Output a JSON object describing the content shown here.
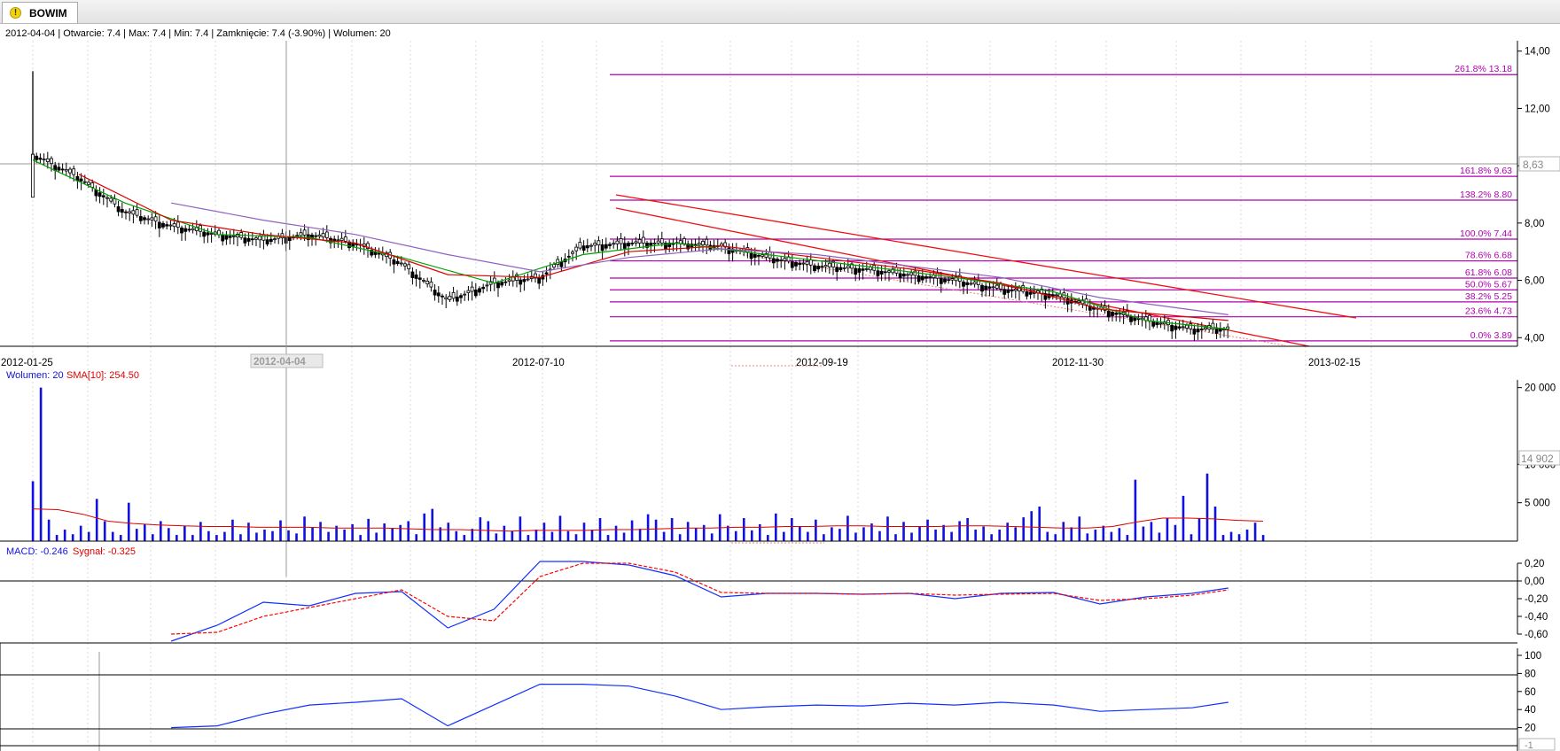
{
  "window": {
    "tab_title": "BOWIM",
    "tab_icon": "warning-icon"
  },
  "header_info": "2012-04-04 | Otwarcie: 7.4 | Max: 7.4 | Min: 7.4 | Zamknięcie: 7.4 (-3.90%)  | Wolumen: 20",
  "x_axis": {
    "labels": [
      "2012-01-25",
      "2012-07-10",
      "2012-09-19",
      "2012-11-30",
      "2013-02-15"
    ],
    "cursor_label": "2012-04-04"
  },
  "colors": {
    "candle": "#000000",
    "sma_green": "#00a000",
    "sma_red": "#e00000",
    "sma_purple": "#9060c0",
    "fib": "#b000b0",
    "trend": "#f01010",
    "volume": "#1010e0",
    "macd": "#1030ff",
    "signal": "#ff0000",
    "rsi": "#1030ff"
  },
  "chart_data": [
    {
      "type": "line",
      "panel": "price",
      "y_ticks": [
        "14,00",
        "12,00",
        "10,00",
        "8,00",
        "6,00",
        "4,00"
      ],
      "ylim": [
        3.7,
        14.3
      ],
      "crosshair_value": "8,63",
      "last_value": 4.3,
      "fibonacci": [
        {
          "label": "261.8% 13.18",
          "value": 13.18
        },
        {
          "label": "161.8% 9.63",
          "value": 9.63
        },
        {
          "label": "138.2% 8.80",
          "value": 8.8
        },
        {
          "label": "100.0% 7.44",
          "value": 7.44
        },
        {
          "label": "78.6% 6.68",
          "value": 6.68
        },
        {
          "label": "61.8% 6.08",
          "value": 6.08
        },
        {
          "label": "50.0% 5.67",
          "value": 5.67
        },
        {
          "label": "38.2% 5.25",
          "value": 5.25
        },
        {
          "label": "23.6% 4.73",
          "value": 4.73
        },
        {
          "label": "0.0% 3.89",
          "value": 3.89
        }
      ],
      "series": [
        {
          "role": "close",
          "x": [
            "2012-01-25",
            "2012-02-08",
            "2012-02-22",
            "2012-03-07",
            "2012-03-21",
            "2012-04-04",
            "2012-04-18",
            "2012-05-02",
            "2012-05-16",
            "2012-05-30",
            "2012-06-13",
            "2012-06-27",
            "2012-07-10",
            "2012-07-24",
            "2012-08-07",
            "2012-08-21",
            "2012-09-04",
            "2012-09-19",
            "2012-10-03",
            "2012-10-17",
            "2012-10-31",
            "2012-11-14",
            "2012-11-30",
            "2012-12-14",
            "2012-12-28",
            "2013-01-11",
            "2013-01-22"
          ],
          "values": [
            10.4,
            9.6,
            8.4,
            7.9,
            7.6,
            7.4,
            7.6,
            7.3,
            6.6,
            5.3,
            5.9,
            6.1,
            7.2,
            7.3,
            7.3,
            7.2,
            6.8,
            6.5,
            6.4,
            6.2,
            6.0,
            5.7,
            5.5,
            5.0,
            4.6,
            4.3,
            4.3
          ]
        },
        {
          "role": "sma-short",
          "x": [
            "2012-01-25",
            "2012-02-22",
            "2012-03-21",
            "2012-04-18",
            "2012-05-16",
            "2012-06-13",
            "2012-07-10",
            "2012-08-07",
            "2012-09-04",
            "2012-10-03",
            "2012-10-31",
            "2012-11-30",
            "2012-12-28",
            "2013-01-22"
          ],
          "values": [
            10.2,
            8.7,
            7.6,
            7.5,
            6.8,
            5.9,
            6.9,
            7.3,
            6.9,
            6.5,
            6.1,
            5.6,
            4.6,
            4.3
          ]
        },
        {
          "role": "sma-mid",
          "x": [
            "2012-02-08",
            "2012-03-07",
            "2012-04-04",
            "2012-05-02",
            "2012-05-30",
            "2012-06-27",
            "2012-07-24",
            "2012-08-21",
            "2012-09-19",
            "2012-10-17",
            "2012-11-14",
            "2012-12-14",
            "2013-01-22"
          ],
          "values": [
            9.7,
            8.1,
            7.6,
            7.3,
            6.2,
            6.1,
            7.0,
            7.2,
            6.8,
            6.4,
            5.9,
            5.0,
            4.6
          ]
        },
        {
          "role": "sma-long",
          "x": [
            "2012-03-07",
            "2012-04-04",
            "2012-05-02",
            "2012-05-30",
            "2012-06-27",
            "2012-07-24",
            "2012-08-21",
            "2012-09-19",
            "2012-10-17",
            "2012-11-14",
            "2012-12-14",
            "2013-01-22"
          ],
          "values": [
            8.7,
            8.1,
            7.6,
            6.9,
            6.3,
            6.8,
            7.1,
            6.9,
            6.5,
            6.1,
            5.4,
            4.8
          ]
        }
      ]
    },
    {
      "type": "bar",
      "panel": "volume",
      "legend": [
        {
          "text": "Wolumen: 20"
        },
        {
          "text": "SMA[10]: 254.50"
        }
      ],
      "y_ticks": [
        "20 000",
        "10 000",
        "5 000"
      ],
      "ylim": [
        0,
        21000
      ],
      "crosshair_value": "14 902",
      "values": [
        7800,
        20000,
        2800,
        800,
        1500,
        900,
        2000,
        1200,
        5500,
        2600,
        1200,
        800,
        5000,
        1600,
        2200,
        900,
        2600,
        1700,
        800,
        2000,
        800,
        2500,
        1300,
        800,
        1200,
        2800,
        900,
        2400,
        1100,
        1500,
        1300,
        2700,
        1400,
        1000,
        3200,
        1800,
        2500,
        1200,
        2000,
        1500,
        2200,
        800,
        2900,
        1100,
        2300,
        1700,
        2100,
        2600,
        900,
        3600,
        4200,
        1800,
        2400,
        1300,
        800,
        1600,
        3100,
        2600,
        1000,
        2000,
        1300,
        3200,
        800,
        1500,
        2400,
        1200,
        3300,
        1300,
        900,
        2400,
        1500,
        3000,
        800,
        2000,
        1100,
        2700,
        1600,
        3500,
        2800,
        1200,
        3000,
        900,
        2500,
        1700,
        2100,
        1000,
        3500,
        2000,
        1300,
        3000,
        1400,
        2200,
        800,
        3600,
        1200,
        3000,
        1900,
        1200,
        2800,
        900,
        1800,
        1600,
        3300,
        1100,
        1800,
        2300,
        1300,
        3200,
        900,
        2500,
        1100,
        1900,
        2800,
        1500,
        2100,
        1200,
        2600,
        3000,
        1500,
        1900,
        900,
        1500,
        2400,
        1800,
        3100,
        3900,
        4500,
        1200,
        900,
        2500,
        1800,
        3200,
        1000,
        1500,
        2000,
        1200,
        1700,
        800,
        8000,
        1900,
        2500,
        1100,
        3000,
        2100,
        5900,
        900,
        3000,
        8800,
        4500,
        800,
        1200,
        900,
        1500,
        2400,
        800
      ],
      "sma": [
        4200,
        4100,
        3500,
        2600,
        2300,
        2100,
        2000,
        1900,
        1900,
        1800,
        1800,
        1800,
        1700,
        1700,
        1700,
        1600,
        1500,
        1500,
        1400,
        1300,
        1400,
        1400,
        1400,
        1500,
        1500,
        1600,
        1700,
        1700,
        1800,
        1800,
        1900,
        1900,
        2000,
        2000,
        1900,
        1900,
        1900,
        2000,
        2000,
        1900,
        1800,
        1700,
        1700,
        1900,
        2500,
        3000,
        3000,
        2900,
        2700,
        2600
      ]
    },
    {
      "type": "line",
      "panel": "macd",
      "legend": [
        {
          "text": "MACD: -0.246"
        },
        {
          "text": "Sygnał: -0.325"
        }
      ],
      "y_ticks": [
        "0,20",
        "0,00",
        "-0,20",
        "-0,40",
        "-0,60"
      ],
      "ylim": [
        -0.7,
        0.3
      ],
      "series": [
        {
          "name": "MACD",
          "x": [
            "2012-03-07",
            "2012-03-21",
            "2012-04-04",
            "2012-04-18",
            "2012-05-02",
            "2012-05-16",
            "2012-05-30",
            "2012-06-13",
            "2012-06-27",
            "2012-07-10",
            "2012-07-24",
            "2012-08-07",
            "2012-08-21",
            "2012-09-04",
            "2012-09-19",
            "2012-10-03",
            "2012-10-17",
            "2012-10-31",
            "2012-11-14",
            "2012-11-30",
            "2012-12-14",
            "2012-12-28",
            "2013-01-11",
            "2013-01-22"
          ],
          "values": [
            -0.68,
            -0.5,
            -0.24,
            -0.28,
            -0.14,
            -0.12,
            -0.53,
            -0.32,
            0.22,
            0.22,
            0.18,
            0.06,
            -0.18,
            -0.14,
            -0.14,
            -0.15,
            -0.14,
            -0.2,
            -0.14,
            -0.13,
            -0.26,
            -0.18,
            -0.14,
            -0.08
          ]
        },
        {
          "name": "Sygnał",
          "x": [
            "2012-03-07",
            "2012-03-21",
            "2012-04-04",
            "2012-04-18",
            "2012-05-02",
            "2012-05-16",
            "2012-05-30",
            "2012-06-13",
            "2012-06-27",
            "2012-07-10",
            "2012-07-24",
            "2012-08-07",
            "2012-08-21",
            "2012-09-04",
            "2012-09-19",
            "2012-10-03",
            "2012-10-17",
            "2012-10-31",
            "2012-11-14",
            "2012-11-30",
            "2012-12-14",
            "2012-12-28",
            "2013-01-11",
            "2013-01-22"
          ],
          "values": [
            -0.6,
            -0.58,
            -0.4,
            -0.3,
            -0.2,
            -0.1,
            -0.4,
            -0.45,
            0.05,
            0.2,
            0.2,
            0.1,
            -0.13,
            -0.14,
            -0.14,
            -0.15,
            -0.14,
            -0.16,
            -0.15,
            -0.14,
            -0.22,
            -0.2,
            -0.16,
            -0.1
          ]
        }
      ]
    },
    {
      "type": "line",
      "panel": "rsi",
      "y_ticks": [
        "100",
        "80",
        "60",
        "40",
        "20",
        "-1"
      ],
      "ylim": [
        0,
        100
      ],
      "levels": [
        80,
        20
      ],
      "series": [
        {
          "x": [
            "2012-03-07",
            "2012-03-21",
            "2012-04-04",
            "2012-04-18",
            "2012-05-02",
            "2012-05-16",
            "2012-05-30",
            "2012-06-13",
            "2012-06-27",
            "2012-07-10",
            "2012-07-24",
            "2012-08-07",
            "2012-08-21",
            "2012-09-04",
            "2012-09-19",
            "2012-10-03",
            "2012-10-17",
            "2012-10-31",
            "2012-11-14",
            "2012-11-30",
            "2012-12-14",
            "2012-12-28",
            "2013-01-11",
            "2013-01-22"
          ],
          "values": [
            20,
            22,
            35,
            45,
            48,
            52,
            22,
            45,
            68,
            68,
            66,
            55,
            40,
            43,
            45,
            44,
            47,
            45,
            48,
            45,
            38,
            40,
            42,
            48
          ]
        }
      ]
    }
  ]
}
